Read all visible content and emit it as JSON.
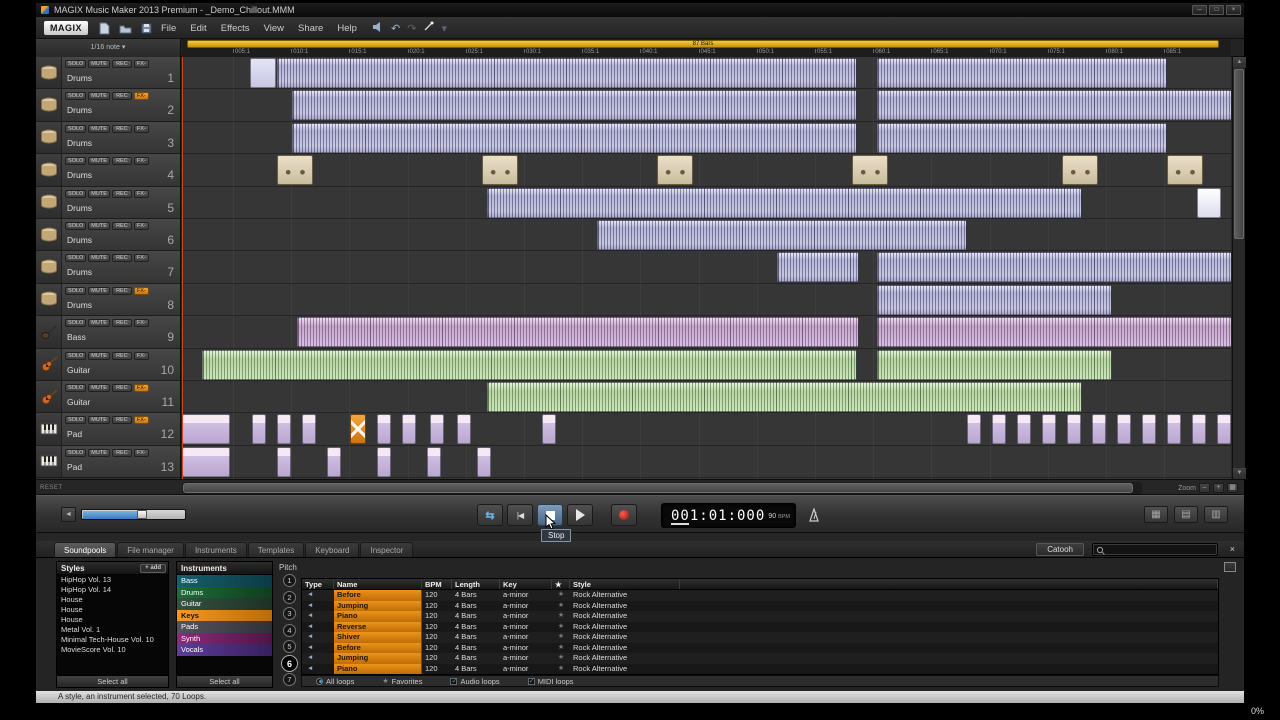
{
  "title_bar": {
    "title": "MAGIX Music Maker 2013 Premium - _Demo_Chillout.MMM",
    "controls": [
      "─",
      "□",
      "×"
    ]
  },
  "menu": {
    "brand": "MAGIX",
    "items": [
      "File",
      "Edit",
      "Effects",
      "View",
      "Share",
      "Help"
    ]
  },
  "timeline": {
    "note_value": "1/16 note",
    "range_label": "87 Bars",
    "ticks": [
      "005:1",
      "010:1",
      "015:1",
      "020:1",
      "025:1",
      "030:1",
      "035:1",
      "040:1",
      "045:1",
      "050:1",
      "055:1",
      "060:1",
      "065:1",
      "070:1",
      "075:1",
      "080:1",
      "085:1"
    ]
  },
  "track_buttons": [
    "SOLO",
    "MUTE",
    "REC"
  ],
  "tracks": [
    {
      "num": "1",
      "name": "Drums",
      "icon": "drums",
      "fx": "FX-",
      "fx_active": false
    },
    {
      "num": "2",
      "name": "Drums",
      "icon": "drums",
      "fx": "FX-",
      "fx_active": true
    },
    {
      "num": "3",
      "name": "Drums",
      "icon": "drums",
      "fx": "FX-",
      "fx_active": false
    },
    {
      "num": "4",
      "name": "Drums",
      "icon": "drums",
      "fx": "FX-",
      "fx_active": false
    },
    {
      "num": "5",
      "name": "Drums",
      "icon": "drums",
      "fx": "FX-",
      "fx_active": false
    },
    {
      "num": "6",
      "name": "Drums",
      "icon": "drums",
      "fx": "FX-",
      "fx_active": false
    },
    {
      "num": "7",
      "name": "Drums",
      "icon": "drums",
      "fx": "FX-",
      "fx_active": false
    },
    {
      "num": "8",
      "name": "Drums",
      "icon": "drums",
      "fx": "FX-",
      "fx_active": true
    },
    {
      "num": "9",
      "name": "Bass",
      "icon": "bass",
      "fx": "FX-",
      "fx_active": false
    },
    {
      "num": "10",
      "name": "Guitar",
      "icon": "guitar",
      "fx": "FX-",
      "fx_active": false
    },
    {
      "num": "11",
      "name": "Guitar",
      "icon": "guitar",
      "fx": "FX-",
      "fx_active": true
    },
    {
      "num": "12",
      "name": "Pad",
      "icon": "keys",
      "fx": "FX-",
      "fx_active": true
    },
    {
      "num": "13",
      "name": "Pad",
      "icon": "keys",
      "fx": "FX-",
      "fx_active": false
    }
  ],
  "clips": [
    [
      0,
      68,
      26,
      "pl"
    ],
    [
      0,
      95,
      580,
      "p"
    ],
    [
      0,
      695,
      290,
      "p"
    ],
    [
      1,
      110,
      565,
      "p"
    ],
    [
      1,
      695,
      355,
      "p"
    ],
    [
      2,
      110,
      565,
      "p"
    ],
    [
      2,
      695,
      290,
      "p"
    ],
    [
      3,
      95,
      36,
      "tan"
    ],
    [
      3,
      300,
      36,
      "tan"
    ],
    [
      3,
      475,
      36,
      "tan"
    ],
    [
      3,
      670,
      36,
      "tan"
    ],
    [
      3,
      880,
      36,
      "tan"
    ],
    [
      3,
      985,
      36,
      "tan"
    ],
    [
      4,
      305,
      595,
      "p"
    ],
    [
      4,
      1015,
      24,
      "w"
    ],
    [
      5,
      415,
      370,
      "p"
    ],
    [
      6,
      595,
      82,
      "p"
    ],
    [
      6,
      695,
      355,
      "p"
    ],
    [
      7,
      695,
      235,
      "p"
    ],
    [
      8,
      115,
      562,
      "pk"
    ],
    [
      8,
      695,
      355,
      "pk"
    ],
    [
      9,
      20,
      655,
      "g"
    ],
    [
      9,
      695,
      235,
      "g"
    ],
    [
      10,
      305,
      595,
      "g"
    ],
    [
      11,
      0,
      48,
      "pad"
    ],
    [
      11,
      70,
      14,
      "pad"
    ],
    [
      11,
      95,
      14,
      "pad"
    ],
    [
      11,
      120,
      14,
      "pad"
    ],
    [
      11,
      168,
      16,
      "sel"
    ],
    [
      11,
      195,
      14,
      "pad"
    ],
    [
      11,
      220,
      14,
      "pad"
    ],
    [
      11,
      248,
      14,
      "pad"
    ],
    [
      11,
      275,
      14,
      "pad"
    ],
    [
      11,
      360,
      14,
      "pad"
    ],
    [
      11,
      785,
      14,
      "pad"
    ],
    [
      11,
      810,
      14,
      "pad"
    ],
    [
      11,
      835,
      14,
      "pad"
    ],
    [
      11,
      860,
      14,
      "pad"
    ],
    [
      11,
      885,
      14,
      "pad"
    ],
    [
      11,
      910,
      14,
      "pad"
    ],
    [
      11,
      935,
      14,
      "pad"
    ],
    [
      11,
      960,
      14,
      "pad"
    ],
    [
      11,
      985,
      14,
      "pad"
    ],
    [
      11,
      1010,
      14,
      "pad"
    ],
    [
      11,
      1035,
      14,
      "pad"
    ],
    [
      12,
      0,
      48,
      "pad"
    ],
    [
      12,
      95,
      14,
      "pad"
    ],
    [
      12,
      145,
      14,
      "pad"
    ],
    [
      12,
      195,
      14,
      "pad"
    ],
    [
      12,
      245,
      14,
      "pad"
    ],
    [
      12,
      295,
      14,
      "pad"
    ]
  ],
  "scrollbar": {
    "reset_label": "RESET",
    "zoom_label": "Zoom"
  },
  "transport": {
    "time": "001:01:000",
    "bpm": "90",
    "bpm_unit": "BPM",
    "tooltip": "Stop"
  },
  "icons": {
    "chevron_down": "▾",
    "scroll_up": "▲",
    "scroll_down": "▼",
    "seek_left": "◄",
    "loop": "⇆",
    "skip_start": "|◀",
    "grid1": "▦",
    "grid2": "▤",
    "grid3": "▥",
    "undo": "↶",
    "redo": "↷",
    "close": "×",
    "star": "★",
    "loop_type": "◄",
    "zoom_out": "–",
    "zoom_in": "+",
    "zoom_grid": "▦",
    "check": "✓"
  },
  "bottom_panel": {
    "tabs": [
      {
        "label": "Soundpools",
        "active": true
      },
      {
        "label": "File manager",
        "active": false
      },
      {
        "label": "Instruments",
        "active": false
      },
      {
        "label": "Templates",
        "active": false
      },
      {
        "label": "Keyboard",
        "active": false
      },
      {
        "label": "Inspector",
        "active": false
      }
    ],
    "catooh_label": "Catooh",
    "styles": {
      "title": "Styles",
      "add_label": "+ add",
      "select_all": "Select all",
      "items": [
        "HipHop Vol. 13",
        "HipHop Vol. 14",
        "House",
        "House",
        "House",
        "Metal Vol. 1",
        "Minimal Tech-House Vol. 10",
        "MovieScore Vol. 10"
      ]
    },
    "instruments": {
      "title": "Instruments",
      "select_all": "Select all",
      "items": [
        {
          "label": "Bass",
          "c1": "#14606e",
          "c2": "#0c3a44",
          "active": false
        },
        {
          "label": "Drums",
          "c1": "#1e6e38",
          "c2": "#0f3d1e",
          "active": false
        },
        {
          "label": "Guitar",
          "c1": "#35523f",
          "c2": "#1d3125",
          "active": false
        },
        {
          "label": "Keys",
          "c1": "#f29a22",
          "c2": "#b86c0c",
          "active": true
        },
        {
          "label": "Pads",
          "c1": "#54545e",
          "c2": "#303038",
          "active": false
        },
        {
          "label": "Synth",
          "c1": "#8c2a7a",
          "c2": "#4e1644",
          "active": false
        },
        {
          "label": "Vocals",
          "c1": "#5e3c98",
          "c2": "#371f5e",
          "active": false
        }
      ]
    },
    "pitch": {
      "label": "Pitch",
      "numbers": [
        "1",
        "2",
        "3",
        "4",
        "5",
        "6",
        "7"
      ],
      "active_index": 5
    },
    "loops": {
      "headers": [
        "Type",
        "Name",
        "BPM",
        "Length",
        "Key",
        "★",
        "Style"
      ],
      "rows": [
        {
          "name": "Before",
          "bpm": "120",
          "length": "4 Bars",
          "key": "a-minor",
          "style": "Rock Alternative"
        },
        {
          "name": "Jumping",
          "bpm": "120",
          "length": "4 Bars",
          "key": "a-minor",
          "style": "Rock Alternative"
        },
        {
          "name": "Piano",
          "bpm": "120",
          "length": "4 Bars",
          "key": "a-minor",
          "style": "Rock Alternative"
        },
        {
          "name": "Reverse",
          "bpm": "120",
          "length": "4 Bars",
          "key": "a-minor",
          "style": "Rock Alternative"
        },
        {
          "name": "Shiver",
          "bpm": "120",
          "length": "4 Bars",
          "key": "a-minor",
          "style": "Rock Alternative"
        },
        {
          "name": "Before",
          "bpm": "120",
          "length": "4 Bars",
          "key": "a-minor",
          "style": "Rock Alternative"
        },
        {
          "name": "Jumping",
          "bpm": "120",
          "length": "4 Bars",
          "key": "a-minor",
          "style": "Rock Alternative"
        },
        {
          "name": "Piano",
          "bpm": "120",
          "length": "4 Bars",
          "key": "a-minor",
          "style": "Rock Alternative"
        }
      ]
    },
    "filters": {
      "all": "All loops",
      "favorites": "Favorites",
      "audio": "Audio loops",
      "midi": "MIDI loops"
    },
    "status": "A style, an instrument selected, 70 Loops."
  },
  "overlay": {
    "percent": "0%"
  }
}
